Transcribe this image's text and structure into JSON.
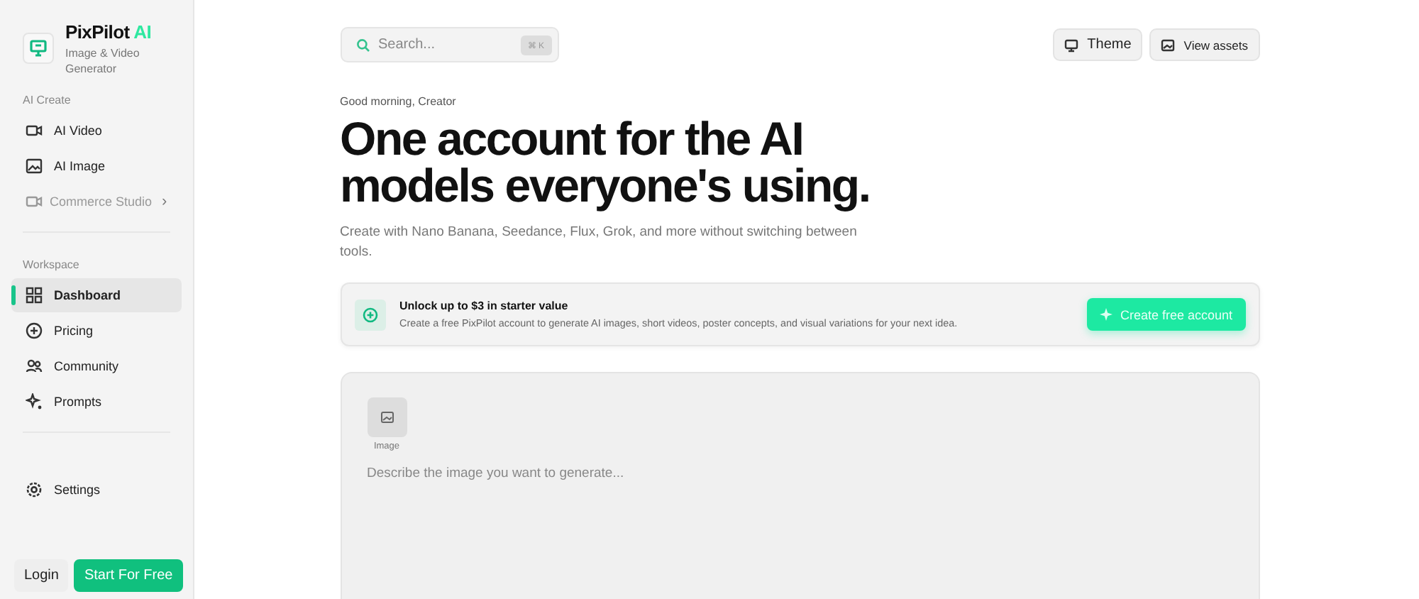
{
  "brand": {
    "name": "PixPilot",
    "accent": "AI",
    "tagline": "Image & Video Generator"
  },
  "sidebar": {
    "sections": [
      {
        "title": "AI Create",
        "items": [
          {
            "label": "AI Video",
            "selected": false,
            "disabled": false
          },
          {
            "label": "AI Image",
            "selected": false,
            "disabled": false
          },
          {
            "label": "Commerce Studio",
            "selected": false,
            "disabled": true,
            "chevron": "›"
          }
        ]
      },
      {
        "title": "Workspace",
        "items": [
          {
            "label": "Dashboard",
            "selected": true,
            "disabled": false
          },
          {
            "label": "Pricing",
            "selected": false,
            "disabled": false
          },
          {
            "label": "Community",
            "selected": false,
            "disabled": false
          },
          {
            "label": "Prompts",
            "selected": false,
            "disabled": false
          }
        ]
      }
    ],
    "settings": "Settings",
    "login": "Login",
    "start": "Start For Free"
  },
  "topbar": {
    "search": {
      "placeholder": "Search...",
      "shortcut": "⌘ K"
    },
    "buttons": [
      "Theme",
      "View assets"
    ]
  },
  "hero": {
    "greeting": "Good morning, Creator",
    "title": "One account for the AI models everyone's using.",
    "subtitle": "Create with Nano Banana, Seedance, Flux, Grok, and more without switching between tools."
  },
  "banner": {
    "title": "Unlock up to $3 in starter value",
    "text": "Create a free PixPilot account to generate AI images, short videos, poster concepts, and visual variations for your next idea.",
    "button": "Create free account"
  },
  "prompt": {
    "mode": "Image",
    "placeholder": "Describe the image you want to generate..."
  }
}
